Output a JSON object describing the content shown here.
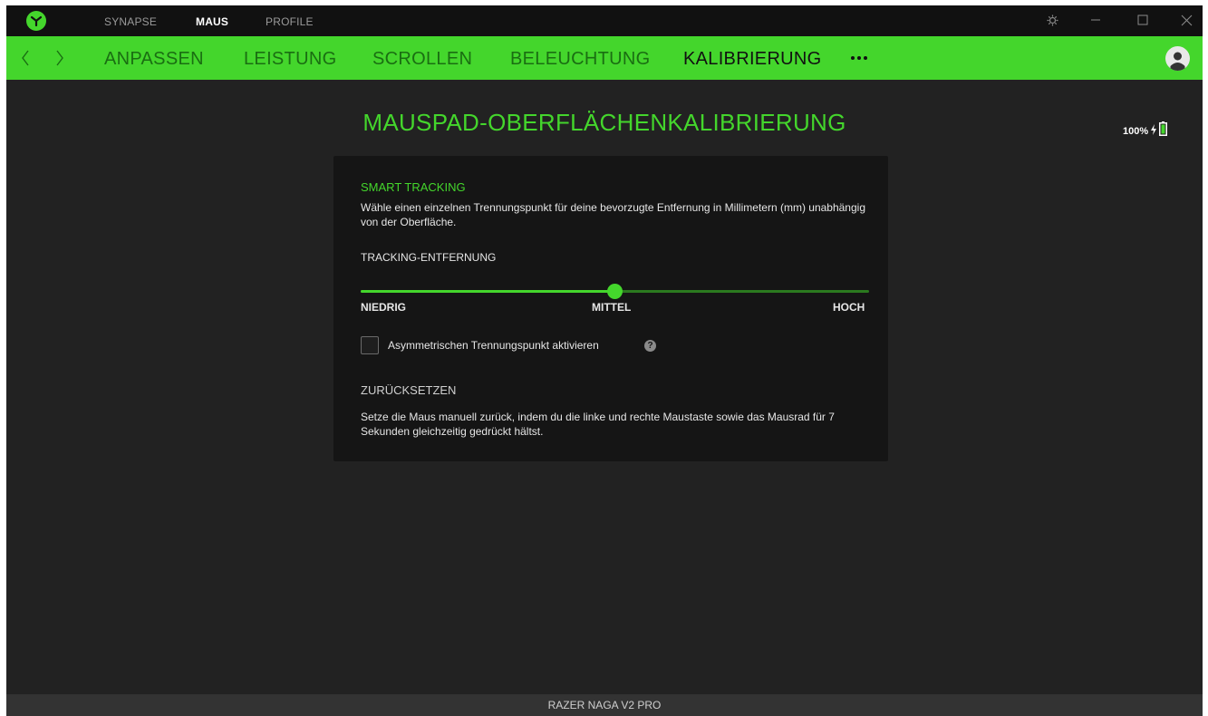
{
  "topbar": {
    "tabs": [
      {
        "label": "SYNAPSE",
        "active": false
      },
      {
        "label": "MAUS",
        "active": true
      },
      {
        "label": "PROFILE",
        "active": false
      }
    ]
  },
  "nav": {
    "tabs": [
      {
        "label": "ANPASSEN",
        "active": false
      },
      {
        "label": "LEISTUNG",
        "active": false
      },
      {
        "label": "SCROLLEN",
        "active": false
      },
      {
        "label": "BELEUCHTUNG",
        "active": false
      },
      {
        "label": "KALIBRIERUNG",
        "active": true
      }
    ]
  },
  "main": {
    "title": "MAUSPAD-OBERFLÄCHENKALIBRIERUNG",
    "battery": "100%",
    "smart_tracking": {
      "title": "SMART TRACKING",
      "description": "Wähle einen einzelnen Trennungspunkt für deine bevorzugte Entfernung in Millimetern (mm) unabhängig von der Oberfläche.",
      "distance_label": "TRACKING-ENTFERNUNG",
      "slider": {
        "labels": [
          "NIEDRIG",
          "MITTEL",
          "HOCH"
        ],
        "value_fraction": 0.5
      },
      "asymmetric_label": "Asymmetrischen Trennungspunkt aktivieren",
      "asymmetric_checked": false
    },
    "reset": {
      "title": "ZURÜCKSETZEN",
      "description": "Setze die Maus manuell zurück, indem du die linke und rechte Maustaste sowie das Mausrad für 7 Sekunden gleichzeitig gedrückt hältst."
    }
  },
  "status": {
    "device": "RAZER NAGA V2 PRO"
  },
  "colors": {
    "accent": "#44d62c",
    "background": "#222222",
    "panel": "#151515"
  }
}
